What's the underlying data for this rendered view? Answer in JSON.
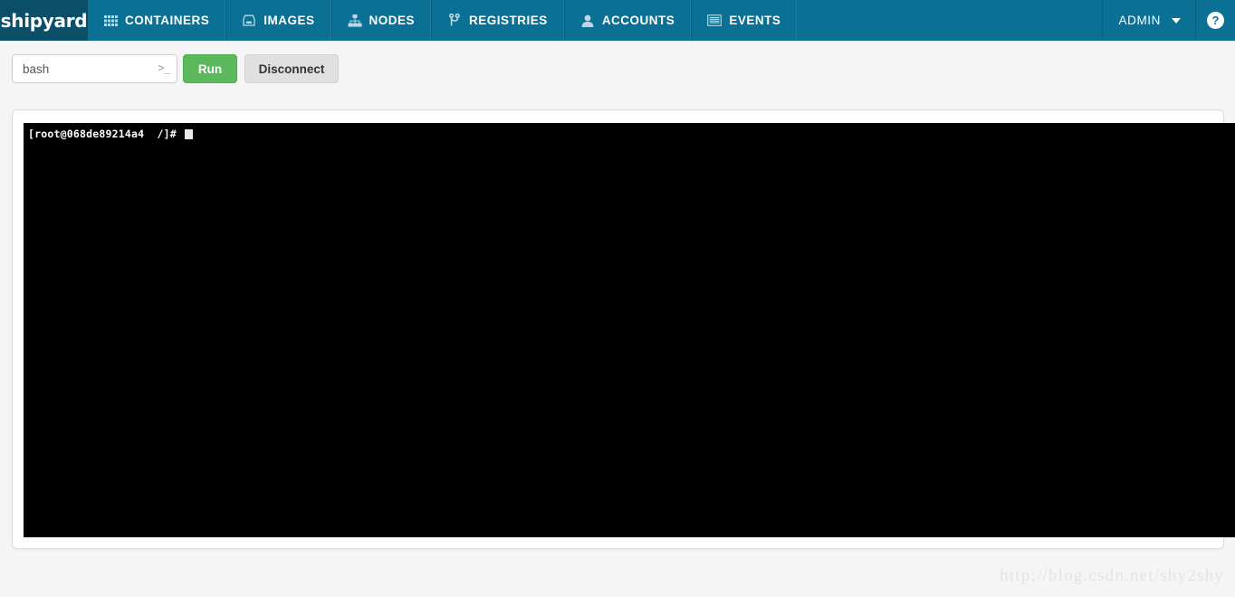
{
  "navbar": {
    "brand": "shipyard",
    "brand_color": "#0a4f67",
    "bar_color": "#0a7194",
    "items": [
      {
        "label": "CONTAINERS",
        "icon": "grid-icon"
      },
      {
        "label": "IMAGES",
        "icon": "hard-drive-icon"
      },
      {
        "label": "NODES",
        "icon": "sitemap-icon"
      },
      {
        "label": "REGISTRIES",
        "icon": "code-fork-icon"
      },
      {
        "label": "ACCOUNTS",
        "icon": "user-icon"
      },
      {
        "label": "EVENTS",
        "icon": "list-icon"
      }
    ],
    "admin": {
      "label": "ADMIN",
      "icon": "caret-down-icon"
    },
    "help": {
      "label": "?",
      "icon": "question-circle-icon"
    }
  },
  "toolbar": {
    "command_value": "bash",
    "command_placeholder": "bash",
    "command_icon": ">_",
    "run_label": "Run",
    "run_color": "#5cb85c",
    "disconnect_label": "Disconnect",
    "disconnect_color": "#e0e0e0"
  },
  "terminal": {
    "prompt": "[root@068de89214a4  /]#",
    "user": "root",
    "host": "068de89214a4",
    "cwd": "/",
    "background": "#000000",
    "foreground": "#ffffff",
    "cursor_visible": true
  },
  "watermark": {
    "text": "http://blog.csdn.net/shy2shy"
  }
}
